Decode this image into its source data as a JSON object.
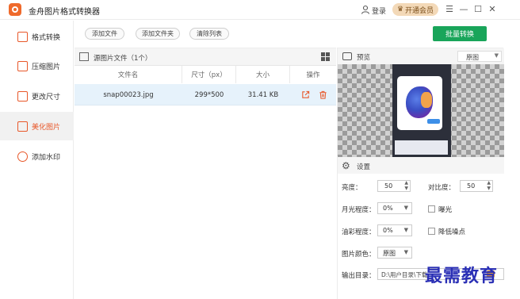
{
  "window": {
    "title": "金舟图片格式转换器",
    "login": "登录",
    "vip": "开通会员",
    "controls": [
      "☰",
      "—",
      "☐",
      "✕"
    ]
  },
  "sidebar": {
    "items": [
      {
        "label": "格式转换",
        "icon": "format-convert-icon"
      },
      {
        "label": "压缩图片",
        "icon": "compress-icon"
      },
      {
        "label": "更改尺寸",
        "icon": "resize-icon"
      },
      {
        "label": "美化图片",
        "icon": "beautify-icon",
        "active": true
      },
      {
        "label": "添加水印",
        "icon": "watermark-icon"
      }
    ]
  },
  "toolbar": {
    "add_file": "添加文件",
    "add_folder": "添加文件夹",
    "clear_list": "清除列表",
    "batch_convert": "批量转换"
  },
  "file_list": {
    "title": "源图片文件（1个）",
    "columns": [
      "文件名",
      "尺寸（px）",
      "大小",
      "操作"
    ],
    "rows": [
      {
        "name": "snap00023.jpg",
        "size_px": "299*500",
        "file_size": "31.41 KB"
      }
    ]
  },
  "preview": {
    "label": "预览",
    "mode": "原图"
  },
  "settings": {
    "label": "设置",
    "brightness_label": "亮度：",
    "brightness": "50",
    "contrast_label": "对比度：",
    "contrast": "50",
    "moonlight_label": "月光程度：",
    "moonlight": "0%",
    "exposure_label": "曝光",
    "oil_label": "油彩程度：",
    "oil": "0%",
    "denoise_label": "降低噪点",
    "color_label": "图片颜色：",
    "color": "原图",
    "output_label": "输出目录：",
    "output": "D:\\用户目录\\下载"
  },
  "watermark": "最需教育",
  "colors": {
    "accent": "#e8582a",
    "primary": "#19a55a",
    "row_highlight": "#e6f2fb"
  }
}
